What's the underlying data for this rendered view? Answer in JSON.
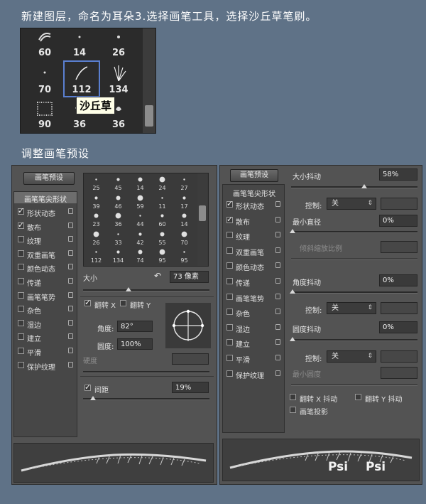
{
  "heading1": "新建图层，命名为耳朵3.选择画笔工具，选择沙丘草笔刷。",
  "heading2": "调整画笔预设",
  "brush_picker": {
    "sizes": [
      "60",
      "14",
      "26",
      "70",
      "112",
      "134",
      "90",
      "36",
      "36"
    ],
    "selected_index": 4,
    "tooltip": "沙丘草"
  },
  "left_panel": {
    "presets_button": "画笔预设",
    "tip_shape_label": "画笔笔尖形状",
    "options": [
      {
        "label": "形状动态",
        "checked": true
      },
      {
        "label": "散布",
        "checked": true
      },
      {
        "label": "纹理",
        "checked": false
      },
      {
        "label": "双重画笔",
        "checked": false
      },
      {
        "label": "颜色动态",
        "checked": false
      },
      {
        "label": "传递",
        "checked": false
      },
      {
        "label": "画笔笔势",
        "checked": false
      },
      {
        "label": "杂色",
        "checked": false
      },
      {
        "label": "湿边",
        "checked": false
      },
      {
        "label": "建立",
        "checked": false
      },
      {
        "label": "平滑",
        "checked": false
      },
      {
        "label": "保护纹理",
        "checked": false
      }
    ],
    "brush_grid_sizes": [
      "25",
      "45",
      "14",
      "24",
      "27",
      "39",
      "46",
      "59",
      "11",
      "17",
      "23",
      "36",
      "44",
      "60",
      "14",
      "26",
      "33",
      "42",
      "55",
      "70",
      "112",
      "134",
      "74",
      "95",
      "95"
    ],
    "size_label": "大小",
    "size_value": "73 像素",
    "flip_x": "翻转 X",
    "flip_y": "翻转 Y",
    "angle_label": "角度:",
    "angle_value": "82°",
    "roundness_label": "圆度:",
    "roundness_value": "100%",
    "hardness_label": "硬度",
    "spacing_label": "间距",
    "spacing_value": "19%"
  },
  "right_panel": {
    "presets_button": "画笔预设",
    "tip_shape_label": "画笔笔尖形状",
    "options": [
      {
        "label": "形状动态",
        "checked": true
      },
      {
        "label": "散布",
        "checked": true
      },
      {
        "label": "纹理",
        "checked": false
      },
      {
        "label": "双重画笔",
        "checked": false
      },
      {
        "label": "颜色动态",
        "checked": false
      },
      {
        "label": "传递",
        "checked": false
      },
      {
        "label": "画笔笔势",
        "checked": false
      },
      {
        "label": "杂色",
        "checked": false
      },
      {
        "label": "湿边",
        "checked": false
      },
      {
        "label": "建立",
        "checked": false
      },
      {
        "label": "平滑",
        "checked": false
      },
      {
        "label": "保护纹理",
        "checked": false
      }
    ],
    "size_jitter_label": "大小抖动",
    "size_jitter_value": "58%",
    "control_label": "控制:",
    "control_value": "关",
    "min_diameter_label": "最小直径",
    "min_diameter_value": "0%",
    "tilt_scale_label": "倾斜缩放比例",
    "angle_jitter_label": "角度抖动",
    "angle_jitter_value": "0%",
    "roundness_jitter_label": "圆度抖动",
    "roundness_jitter_value": "0%",
    "min_roundness_label": "最小圆度",
    "flip_x_jitter": "翻转 X 抖动",
    "flip_y_jitter": "翻转 Y 抖动",
    "brush_projection": "画笔投影"
  },
  "watermark": "Psi"
}
